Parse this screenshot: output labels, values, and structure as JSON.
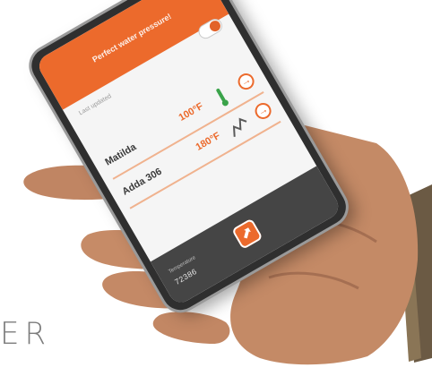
{
  "brand_text": "ER",
  "header": {
    "title": "Perfect water pressure!"
  },
  "status_line": "Last updated",
  "devices": [
    {
      "name": "Matilda",
      "temperature": "100°F",
      "icon": "thermometer-icon",
      "action_icon": "arrow-right-circle-icon"
    },
    {
      "name": "Adda 306",
      "temperature": "180°F",
      "icon": "line-graph-icon",
      "action_icon": "arrow-right-circle-icon"
    }
  ],
  "footer": {
    "label": "Temperature",
    "code": "72386"
  },
  "colors": {
    "accent": "#ec6a2c",
    "footer": "#454545",
    "screen": "#f5f5f5"
  }
}
